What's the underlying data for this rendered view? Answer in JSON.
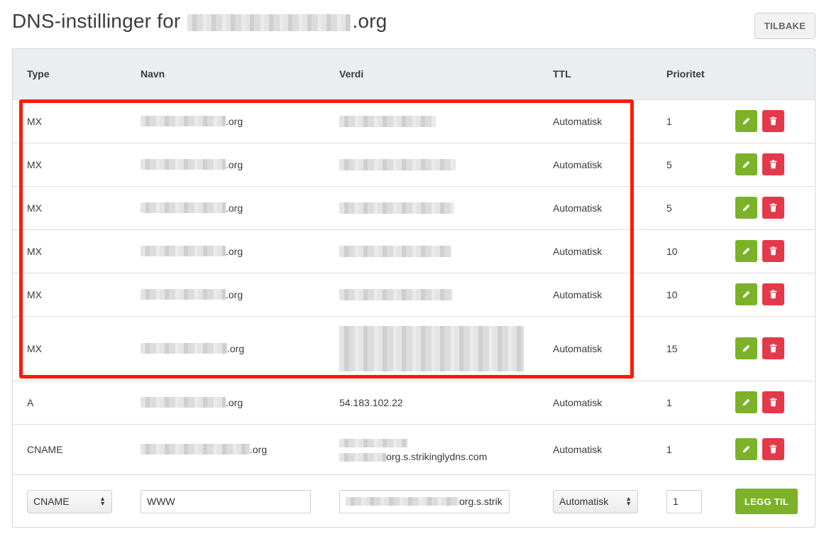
{
  "title": {
    "prefix": "DNS-instillinger for",
    "suffix": ".org"
  },
  "back_button": "TILBAKE",
  "columns": {
    "type": "Type",
    "name": "Navn",
    "value": "Verdi",
    "ttl": "TTL",
    "priority": "Priorite­t"
  },
  "rows": [
    {
      "type": "MX",
      "name_suffix": ".org",
      "ttl": "Automatisk",
      "priority": "1"
    },
    {
      "type": "MX",
      "name_suffix": ".org",
      "ttl": "Automatisk",
      "priority": "5"
    },
    {
      "type": "MX",
      "name_suffix": ".org",
      "ttl": "Automatisk",
      "priority": "5"
    },
    {
      "type": "MX",
      "name_suffix": ".org",
      "ttl": "Automatisk",
      "priority": "10"
    },
    {
      "type": "MX",
      "name_suffix": ".org",
      "ttl": "Automatisk",
      "priority": "10"
    },
    {
      "type": "MX",
      "name_suffix": ".org",
      "ttl": "Automatisk",
      "priority": "15"
    },
    {
      "type": "A",
      "name_suffix": ".org",
      "value": "54.183.102.22",
      "ttl": "Automatisk",
      "priority": "1"
    },
    {
      "type": "CNAME",
      "name_suffix": ".org",
      "value_suffix": "org.s.strikinglydns.com",
      "ttl": "Automatisk",
      "priority": "1"
    }
  ],
  "new_record": {
    "type": "CNAME",
    "name": "WWW",
    "value_suffix": "org.s.strik",
    "ttl": "Automatisk",
    "priority": "1",
    "add_button": "LEGG TIL"
  },
  "colors": {
    "edit": "#7cb228",
    "delete": "#e3394a",
    "highlight": "#ff1a0a",
    "header_bg": "#ebedf1"
  },
  "icons": {
    "edit": "pencil-icon",
    "delete": "trash-icon",
    "select": "select-arrows-icon"
  }
}
